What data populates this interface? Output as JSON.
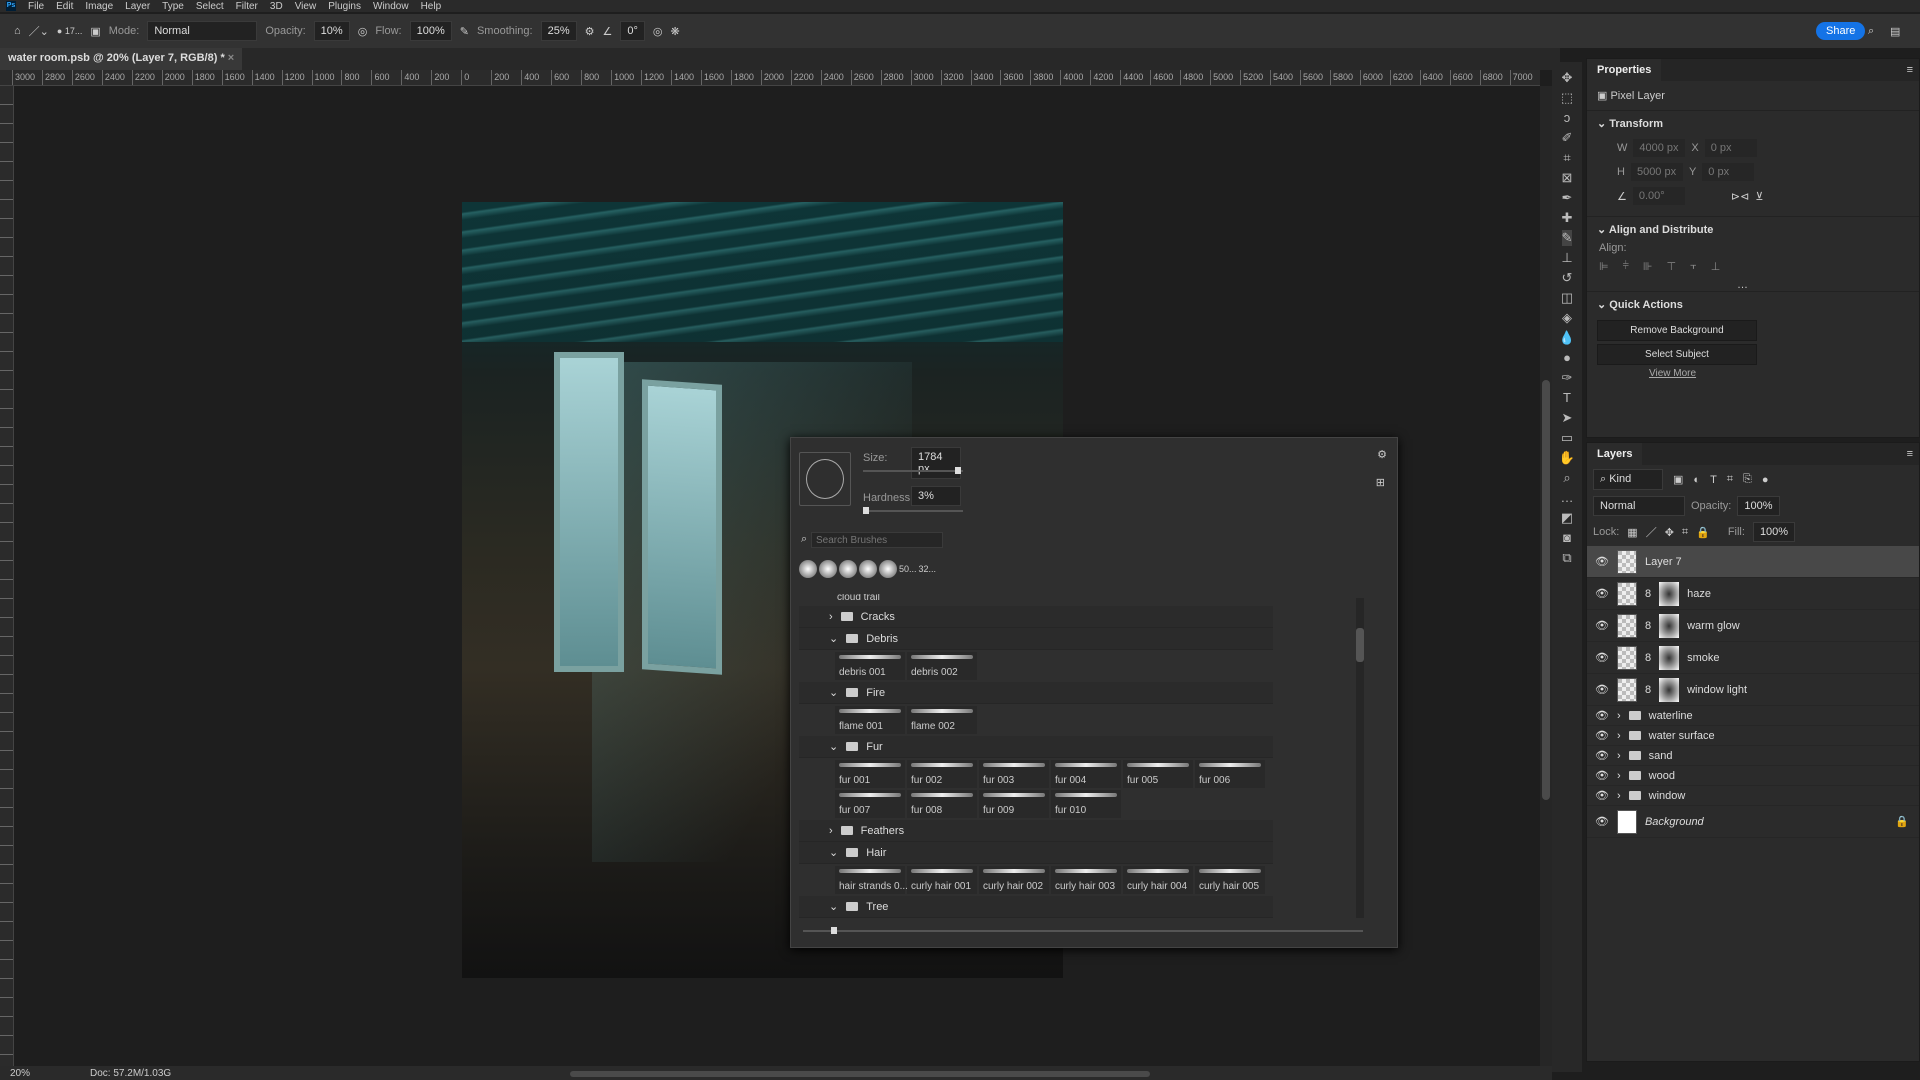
{
  "menu": [
    "File",
    "Edit",
    "Image",
    "Layer",
    "Type",
    "Select",
    "Filter",
    "3D",
    "View",
    "Plugins",
    "Window",
    "Help"
  ],
  "options": {
    "brush_size": "17...",
    "mode_label": "Mode:",
    "mode": "Normal",
    "opacity_label": "Opacity:",
    "opacity": "10%",
    "flow_label": "Flow:",
    "flow": "100%",
    "smoothing_label": "Smoothing:",
    "smoothing": "25%",
    "angle": "0°",
    "share": "Share"
  },
  "document_tab": "water room.psb @ 20% (Layer 7, RGB/8) *",
  "ruler": [
    "3000",
    "2800",
    "2600",
    "2400",
    "2200",
    "2000",
    "1800",
    "1600",
    "1400",
    "1200",
    "1000",
    "800",
    "600",
    "400",
    "200",
    "0",
    "200",
    "400",
    "600",
    "800",
    "1000",
    "1200",
    "1400",
    "1600",
    "1800",
    "2000",
    "2200",
    "2400",
    "2600",
    "2800",
    "3000",
    "3200",
    "3400",
    "3600",
    "3800",
    "4000",
    "4200",
    "4400",
    "4600",
    "4800",
    "5000",
    "5200",
    "5400",
    "5600",
    "5800",
    "6000",
    "6200",
    "6400",
    "6600",
    "6800",
    "7000"
  ],
  "status": {
    "zoom": "20%",
    "doc": "Doc: 57.2M/1.03G"
  },
  "properties": {
    "title": "Properties",
    "type": "Pixel Layer",
    "transform": "Transform",
    "w_label": "W",
    "w": "4000 px",
    "x_label": "X",
    "x": "0 px",
    "h_label": "H",
    "h": "5000 px",
    "y_label": "Y",
    "y": "0 px",
    "angle": "0.00°",
    "align_title": "Align and Distribute",
    "align_label": "Align:",
    "quick_title": "Quick Actions",
    "remove_bg": "Remove Background",
    "select_subject": "Select Subject",
    "view_more": "View More"
  },
  "layers": {
    "title": "Layers",
    "kind": "Kind",
    "blend": "Normal",
    "opacity_label": "Opacity:",
    "opacity": "100%",
    "lock_label": "Lock:",
    "fill_label": "Fill:",
    "fill": "100%",
    "items": [
      {
        "name": "Layer 7",
        "type": "pixel",
        "selected": true
      },
      {
        "name": "haze",
        "type": "masked"
      },
      {
        "name": "warm glow",
        "type": "masked"
      },
      {
        "name": "smoke",
        "type": "masked"
      },
      {
        "name": "window light",
        "type": "masked"
      },
      {
        "name": "waterline",
        "type": "group"
      },
      {
        "name": "water surface",
        "type": "group"
      },
      {
        "name": "sand",
        "type": "group"
      },
      {
        "name": "wood",
        "type": "group"
      },
      {
        "name": "window",
        "type": "group"
      },
      {
        "name": "Background",
        "type": "background",
        "locked": true
      }
    ]
  },
  "brush_panel": {
    "size_label": "Size:",
    "size": "1784 px",
    "size_fraction": 0.95,
    "hardness_label": "Hardness:",
    "hardness": "3%",
    "hardness_percent": 3,
    "search_placeholder": "Search Brushes",
    "recent": [
      "50...",
      "32..."
    ],
    "partial_item": "cloud  trail",
    "groups": [
      {
        "name": "Cracks",
        "expanded": false,
        "items": []
      },
      {
        "name": "Debris",
        "expanded": true,
        "items": [
          "debris  001",
          "debris  002"
        ]
      },
      {
        "name": "Fire",
        "expanded": true,
        "items": [
          "flame  001",
          "flame  002"
        ]
      },
      {
        "name": "Fur",
        "expanded": true,
        "items": [
          "fur  001",
          "fur  002",
          "fur  003",
          "fur  004",
          "fur  005",
          "fur  006",
          "fur 007",
          "fur 008",
          "fur 009",
          "fur 010"
        ]
      },
      {
        "name": "Feathers",
        "expanded": false,
        "items": []
      },
      {
        "name": "Hair",
        "expanded": true,
        "items": [
          "hair strands  0...",
          "curly  hair  001",
          "curly  hair  002",
          "curly  hair  003",
          "curly  hair  004",
          "curly  hair  005"
        ]
      },
      {
        "name": "Tree",
        "expanded": true,
        "items": []
      }
    ]
  },
  "colors": {
    "accent": "#1473e6",
    "panel": "#2b2b2b",
    "canvas_bg": "#1e1e1e"
  }
}
